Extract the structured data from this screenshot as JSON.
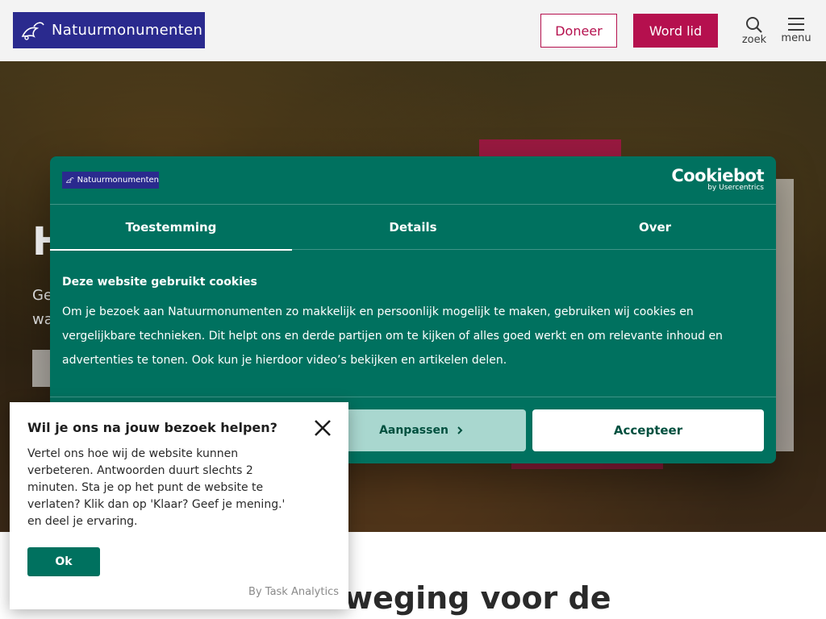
{
  "header": {
    "logo_text": "Natuurmonumenten",
    "doneer_label": "Doneer",
    "word_lid_label": "Word lid",
    "zoek_label": "zoek",
    "menu_label": "menu"
  },
  "hero": {
    "title_visible": "H",
    "subtitle_lines": [
      "Ge",
      "wa"
    ]
  },
  "lower": {
    "title_visible": "Een beweging voor de"
  },
  "cookie_dialog": {
    "logo_text": "Natuurmonumenten",
    "brand_main": "Cookiebot",
    "brand_by": "by Usercentrics",
    "tabs": [
      {
        "label": "Toestemming",
        "active": true
      },
      {
        "label": "Details",
        "active": false
      },
      {
        "label": "Over",
        "active": false
      }
    ],
    "body_title": "Deze website gebruikt cookies",
    "body_text": "Om je bezoek aan Natuurmonumenten zo makkelijk en persoonlijk mogelijk te maken, gebruiken wij cookies en vergelijkbare technieken. Dit helpt ons en derde partijen om te kijken of alles goed werkt en om relevante inhoud en advertenties te tonen. Ook kun je hierdoor video’s bekijken en artikelen delen.",
    "aanpassen_label": "Aanpassen",
    "accepteer_label": "Accepteer"
  },
  "survey": {
    "title": "Wil je ons na jouw bezoek helpen?",
    "text": "Vertel ons hoe wij de website kunnen verbeteren. Antwoorden duurt slechts 2 minuten. Sta je op het punt de website te verlaten? Klik dan op 'Klaar? Geef je mening.' en deel je ervaring.",
    "ok_label": "Ok",
    "by_label": "By Task Analytics"
  },
  "colors": {
    "brand_pink": "#b5104e",
    "cookie_green": "#00715f",
    "logo_blue": "#2a2a8e"
  }
}
